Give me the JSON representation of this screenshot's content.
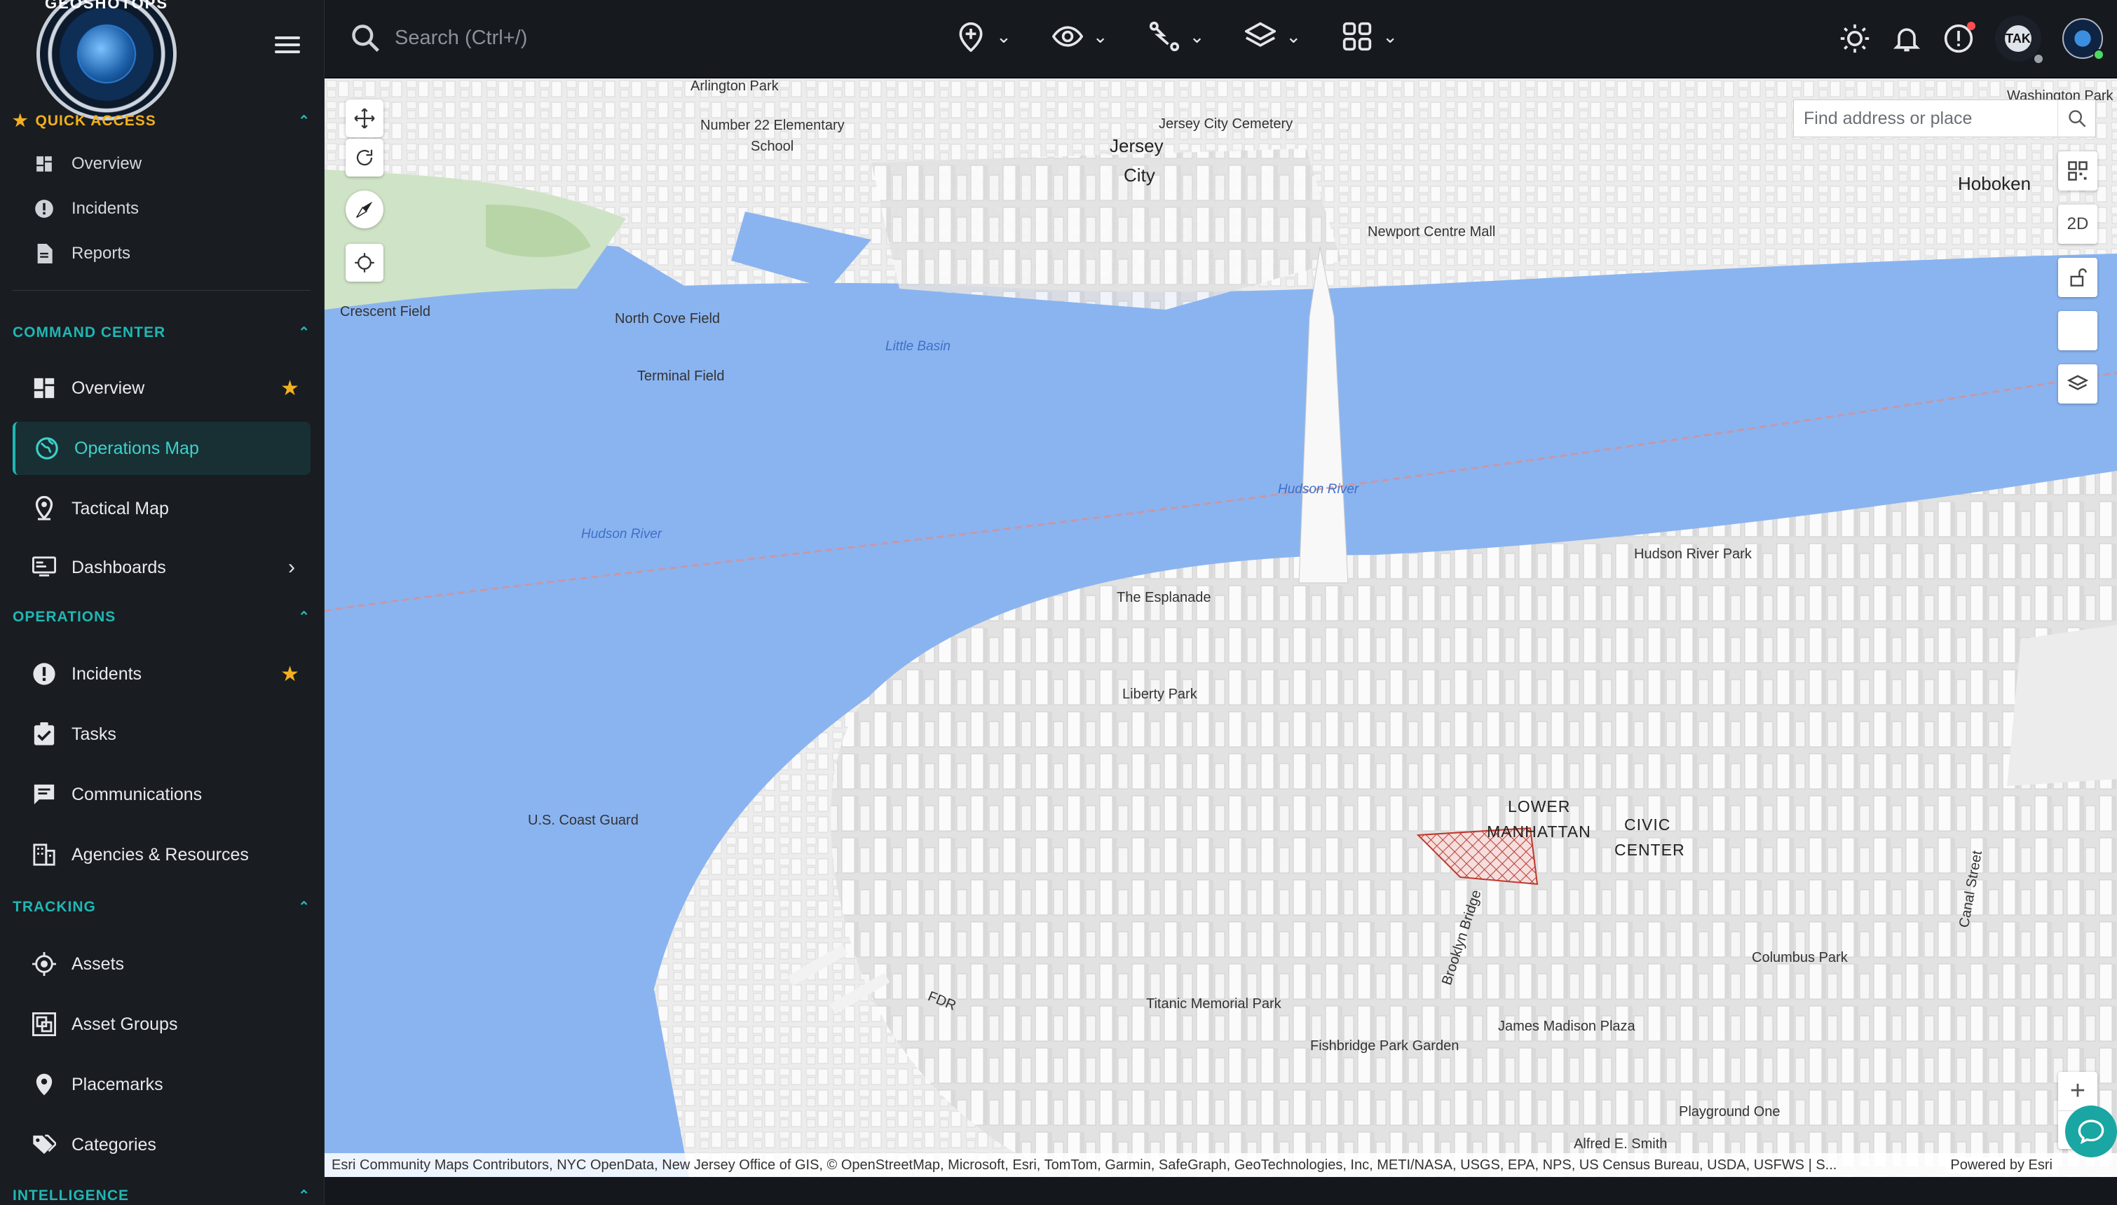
{
  "app": {
    "logo_text": "GEOSHOTOPS"
  },
  "quick_access": {
    "title": "QUICK ACCESS",
    "items": [
      {
        "label": "Overview",
        "icon": "dashboard-icon"
      },
      {
        "label": "Incidents",
        "icon": "alert-circle-icon"
      },
      {
        "label": "Reports",
        "icon": "document-icon"
      }
    ]
  },
  "sections": {
    "command_center": {
      "title": "COMMAND CENTER",
      "items": [
        {
          "label": "Overview",
          "icon": "dashboard-icon",
          "starred": true
        },
        {
          "label": "Operations Map",
          "icon": "globe-icon",
          "active": true
        },
        {
          "label": "Tactical Map",
          "icon": "map-pin-icon"
        },
        {
          "label": "Dashboards",
          "icon": "monitor-icon",
          "expandable": true
        }
      ]
    },
    "operations": {
      "title": "OPERATIONS",
      "items": [
        {
          "label": "Incidents",
          "icon": "alert-circle-icon",
          "starred": true
        },
        {
          "label": "Tasks",
          "icon": "clipboard-check-icon"
        },
        {
          "label": "Communications",
          "icon": "message-icon"
        },
        {
          "label": "Agencies & Resources",
          "icon": "building-icon"
        }
      ]
    },
    "tracking": {
      "title": "TRACKING",
      "items": [
        {
          "label": "Assets",
          "icon": "crosshair-icon"
        },
        {
          "label": "Asset Groups",
          "icon": "group-icon"
        },
        {
          "label": "Placemarks",
          "icon": "map-pin-icon"
        },
        {
          "label": "Categories",
          "icon": "tags-icon"
        }
      ]
    },
    "intelligence": {
      "title": "INTELLIGENCE"
    }
  },
  "topbar": {
    "search_placeholder": "Search (Ctrl+/)",
    "tools": [
      "add-location-icon",
      "eye-icon",
      "route-icon",
      "layers-icon",
      "grid-icon"
    ],
    "tak_label": "TAK"
  },
  "map": {
    "find_placeholder": "Find address or place",
    "view_mode": "2D",
    "labels": [
      {
        "text": "Arlington Park"
      },
      {
        "text": "Number 22 Elementary"
      },
      {
        "text": "School"
      },
      {
        "text": "Jersey"
      },
      {
        "text": "City"
      },
      {
        "text": "Jersey City Cemetery"
      },
      {
        "text": "Washington Park"
      },
      {
        "text": "Hoboken"
      },
      {
        "text": "Newport Centre Mall"
      },
      {
        "text": "Crescent Field"
      },
      {
        "text": "North Cove Field"
      },
      {
        "text": "Little Basin"
      },
      {
        "text": "Terminal Field"
      },
      {
        "text": "Hudson River"
      },
      {
        "text": "Hudson River Park"
      },
      {
        "text": "The Esplanade"
      },
      {
        "text": "Liberty Park"
      },
      {
        "text": "U.S. Coast Guard"
      },
      {
        "text": "LOWER"
      },
      {
        "text": "MANHATTAN"
      },
      {
        "text": "CIVIC"
      },
      {
        "text": "CENTER"
      },
      {
        "text": "Columbus Park"
      },
      {
        "text": "Titanic Memorial Park"
      },
      {
        "text": "James Madison Plaza"
      },
      {
        "text": "Fishbridge Park Garden"
      },
      {
        "text": "Playground One"
      },
      {
        "text": "Alfred E. Smith"
      },
      {
        "text": "Brooklyn Bridge"
      },
      {
        "text": "Canal Street"
      },
      {
        "text": "FDR"
      }
    ],
    "attribution": "Esri Community Maps Contributors, NYC OpenData, New Jersey Office of GIS, © OpenStreetMap, Microsoft, Esri, TomTom, Garmin, SafeGraph, GeoTechnologies, Inc, METI/NASA, USGS, EPA, NPS, US Census Bureau, USDA, USFWS | S...",
    "powered": "Powered by Esri"
  },
  "colors": {
    "accent": "#1fb7b4",
    "star": "#f2b01e",
    "water": "#8ab4f0",
    "land": "#ececec"
  }
}
